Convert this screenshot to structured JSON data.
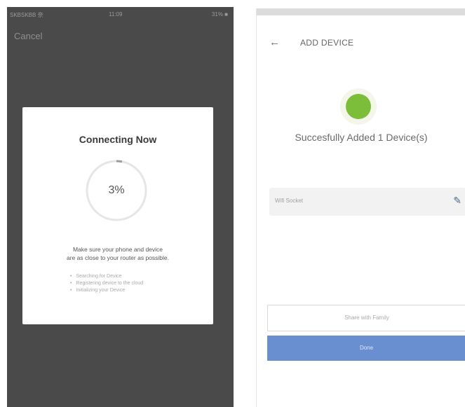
{
  "left_screen": {
    "status_bar": {
      "carrier": "SKBSKBB 奈",
      "time": "11:09",
      "battery": "31% ■"
    },
    "cancel_label": "Cancel",
    "modal": {
      "title": "Connecting Now",
      "progress_text": "3%",
      "progress_fraction": 0.03,
      "hint_line1": "Make sure your phone and device",
      "hint_line2": "are as close to your router as possible.",
      "steps": [
        "Searching for Device",
        "Registering device to the cloud",
        "Initializing your Device"
      ]
    }
  },
  "right_screen": {
    "status_bar": {
      "carrier": "",
      "time": "",
      "battery": ""
    },
    "back_icon": "arrow-left-icon",
    "title": "ADD DEVICE",
    "success_text": "Succesfully Added 1 Device(s)",
    "device_name": "Wifi Socket",
    "edit_icon": "pencil-icon",
    "share_label": "Share with Family",
    "done_label": "Done",
    "accent_color": "#7cbd3a",
    "button_color": "#6a8fd1"
  }
}
